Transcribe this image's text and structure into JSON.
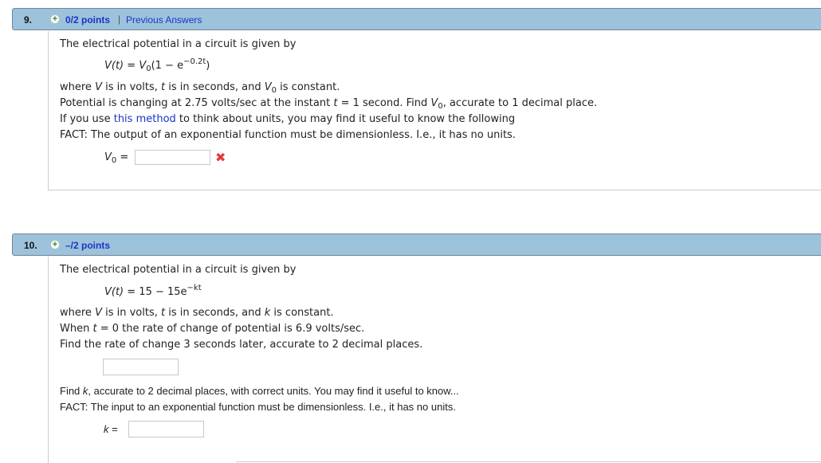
{
  "questions": [
    {
      "number": "9.",
      "plus_icon": "+",
      "points": "0/2 points",
      "separator": "|",
      "previous_answers": "Previous Answers",
      "intro": "The electrical potential in a circuit is given by",
      "formula": {
        "lhs": "V(t)",
        "eq": " = ",
        "v": "V",
        "v_sub": "0",
        "rest": "(1 − e",
        "exp": "−0.2t",
        "close": ")"
      },
      "line1": {
        "a": "where ",
        "V": "V",
        "b": " is in volts, ",
        "t": "t",
        "c": " is in seconds, and ",
        "V0": "V",
        "V0_sub": "0",
        "d": " is constant."
      },
      "line2": {
        "a": "Potential is changing at 2.75 volts/sec at the instant ",
        "t": "t",
        "b": " = 1 second. Find ",
        "V0": "V",
        "V0_sub": "0",
        "c": ", accurate to 1 decimal place."
      },
      "line3": {
        "a": "If you use ",
        "link": "this method",
        "b": " to think about units, you may find it useful to know the following"
      },
      "line4": "FACT: The output of an exponential function must be dimensionless. I.e., it has no units.",
      "answer_label": {
        "v": "V",
        "sub": "0",
        "eq": " ="
      },
      "answer_value": "",
      "status_icon": "✖"
    },
    {
      "number": "10.",
      "plus_icon": "+",
      "points": "–/2 points",
      "intro": "The electrical potential in a circuit is given by",
      "formula": {
        "lhs": "V(t)",
        "eq": " = 15 − 15e",
        "exp": "−kt"
      },
      "line1": {
        "a": "where ",
        "V": "V",
        "b": " is in volts, ",
        "t": "t",
        "c": " is in seconds, and ",
        "k": "k",
        "d": " is constant."
      },
      "line2": {
        "a": "When ",
        "t": "t",
        "b": " = 0 the rate of change of potential is 6.9 volts/sec."
      },
      "line3": "Find the rate of change 3 seconds later, accurate to 2 decimal places.",
      "answer1_value": "",
      "line4": {
        "a": "Find ",
        "k": "k",
        "b": ", accurate to 2 decimal places, with correct units. You may find it useful to know..."
      },
      "line5": "FACT: The input to an exponential function must be dimensionless. I.e., it has no units.",
      "answer_label": {
        "k": "k",
        "eq": " ="
      },
      "answer2_value": ""
    }
  ]
}
